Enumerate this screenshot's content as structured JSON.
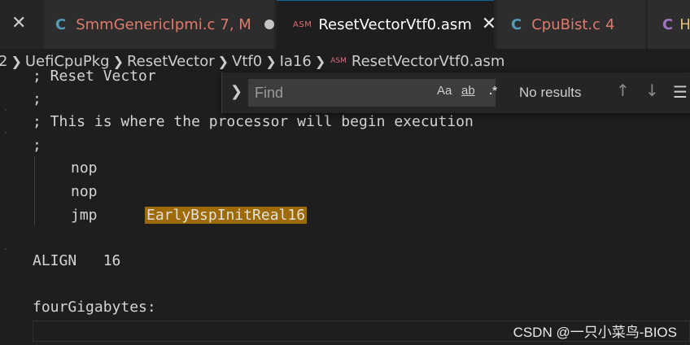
{
  "tabs": [
    {
      "icon": "C",
      "label": "SmmGenericIpmi.c",
      "status": "7, M"
    },
    {
      "icon": "ASM",
      "label": "ResetVectorVtf0.asm"
    },
    {
      "icon": "C",
      "label": "CpuBist.c",
      "status": "4"
    },
    {
      "icon": "C",
      "label": "H"
    }
  ],
  "breadcrumb": {
    "items": [
      "2",
      "UefiCpuPkg",
      "ResetVector",
      "Vtf0",
      "Ia16"
    ],
    "file_icon": "ASM",
    "file": "ResetVectorVtf0.asm"
  },
  "find": {
    "placeholder": "Find",
    "match_case": "Aa",
    "whole_word": "ab",
    "regex": ".*",
    "results": "No results"
  },
  "code": {
    "line1": "; Reset Vector",
    "line2": ";",
    "line3": "; This is where the processor will begin execution",
    "line4": ";",
    "line5": "nop",
    "line6": "nop",
    "line7_instr": "jmp",
    "line7_target": "EarlyBspInitReal16",
    "line8": "ALIGN   16",
    "line9": "fourGigabytes:"
  },
  "watermark": "CSDN @一只小菜鸟-BIOS",
  "colors": {
    "background": "#1e1e1e",
    "tab_modified": "#e07a6a",
    "find_highlight": "#9e6a03",
    "c_icon": "#519aba"
  }
}
